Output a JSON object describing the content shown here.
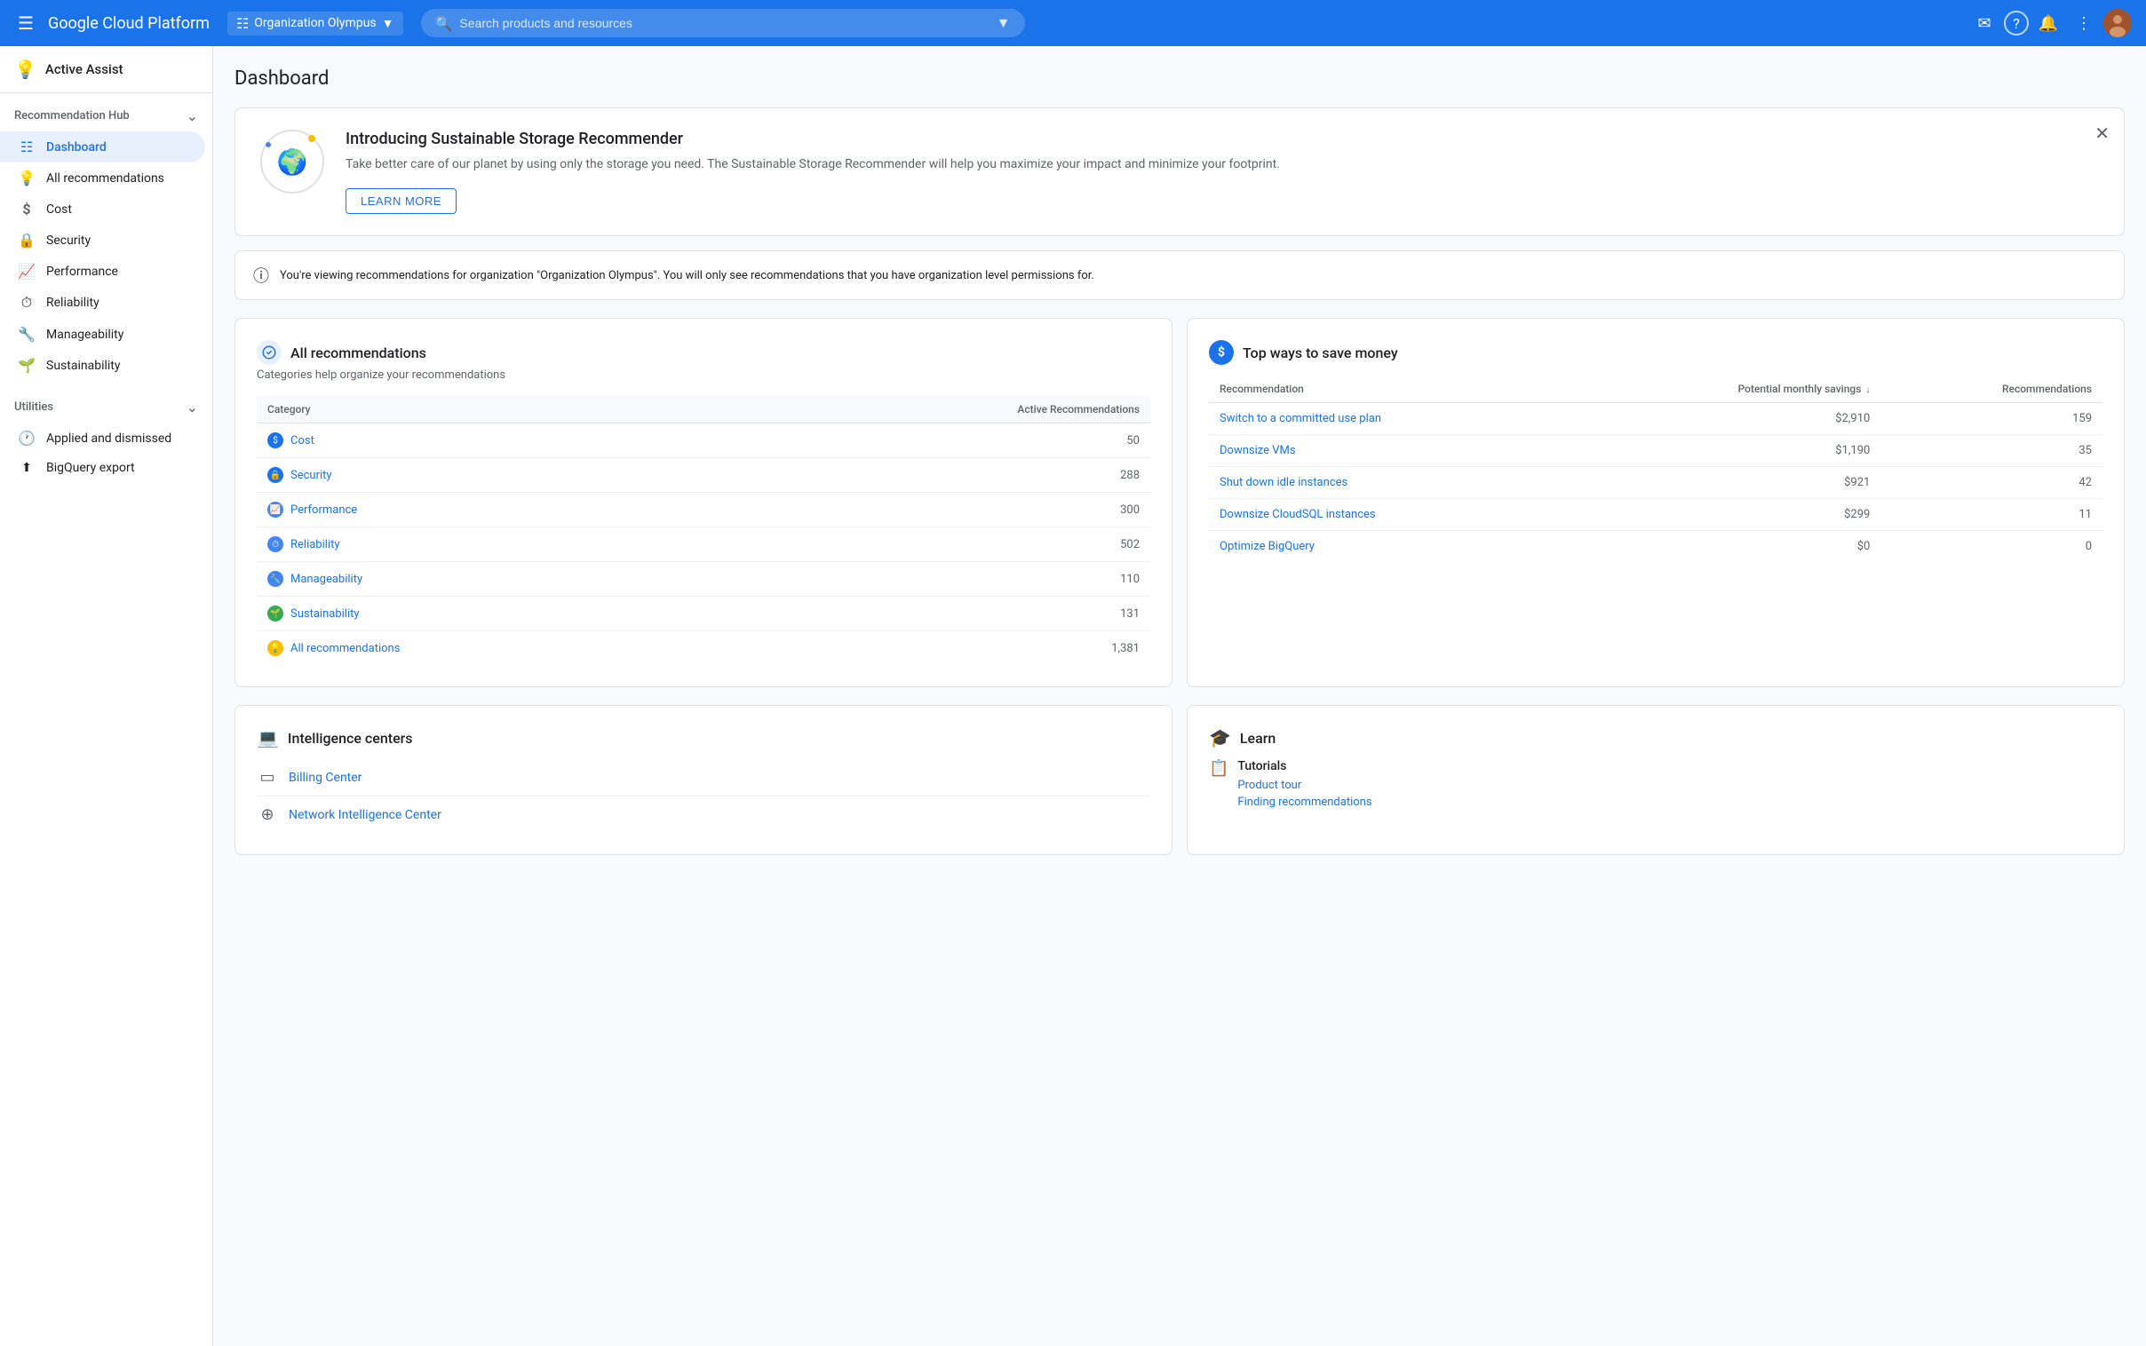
{
  "topNav": {
    "hamburger": "☰",
    "brand": "Google Cloud Platform",
    "org": {
      "icon": "⊞",
      "name": "Organization Olympus",
      "arrow": "▾"
    },
    "search": {
      "placeholder": "Search products and resources",
      "icon": "🔍",
      "dropdownArrow": "▾"
    },
    "actions": {
      "email": "✉",
      "help": "?",
      "bell": "🔔",
      "more": "⋮"
    }
  },
  "sidebar": {
    "activeAssist": {
      "icon": "💡",
      "label": "Active Assist"
    },
    "sections": [
      {
        "id": "recommendation-hub",
        "label": "Recommendation Hub",
        "hasChevron": true,
        "items": [
          {
            "id": "dashboard",
            "icon": "⊞",
            "label": "Dashboard",
            "active": true
          },
          {
            "id": "all-recommendations",
            "icon": "💡",
            "label": "All recommendations"
          }
        ]
      },
      {
        "id": "categories",
        "label": "",
        "items": [
          {
            "id": "cost",
            "icon": "$",
            "label": "Cost"
          },
          {
            "id": "security",
            "icon": "🔒",
            "label": "Security"
          },
          {
            "id": "performance",
            "icon": "📈",
            "label": "Performance"
          },
          {
            "id": "reliability",
            "icon": "⏱",
            "label": "Reliability"
          },
          {
            "id": "manageability",
            "icon": "🔧",
            "label": "Manageability"
          },
          {
            "id": "sustainability",
            "icon": "🌱",
            "label": "Sustainability"
          }
        ]
      },
      {
        "id": "utilities",
        "label": "Utilities",
        "hasChevron": true,
        "items": [
          {
            "id": "applied-dismissed",
            "icon": "🕐",
            "label": "Applied and dismissed"
          },
          {
            "id": "bigquery-export",
            "icon": "⬆",
            "label": "BigQuery export"
          }
        ]
      }
    ]
  },
  "main": {
    "title": "Dashboard",
    "banner": {
      "title": "Introducing Sustainable Storage Recommender",
      "description": "Take better care of our planet by using only the storage you need. The Sustainable Storage Recommender will help you maximize your impact and minimize your footprint.",
      "learnMoreLabel": "LEARN MORE"
    },
    "infoBar": {
      "icon": "ℹ",
      "text": "You're viewing recommendations for organization \"Organization Olympus\". You will only see recommendations that you have organization level permissions for."
    },
    "allRecommendations": {
      "title": "All recommendations",
      "subtitle": "Categories help organize your recommendations",
      "tableHeaders": {
        "category": "Category",
        "activeRecs": "Active Recommendations"
      },
      "rows": [
        {
          "id": "cost",
          "iconType": "cost",
          "iconSymbol": "$",
          "name": "Cost",
          "count": "50"
        },
        {
          "id": "security",
          "iconType": "security",
          "iconSymbol": "🔒",
          "name": "Security",
          "count": "288"
        },
        {
          "id": "performance",
          "iconType": "performance",
          "iconSymbol": "📈",
          "name": "Performance",
          "count": "300"
        },
        {
          "id": "reliability",
          "iconType": "reliability",
          "iconSymbol": "⏱",
          "name": "Reliability",
          "count": "502"
        },
        {
          "id": "manageability",
          "iconType": "manageability",
          "iconSymbol": "🔧",
          "name": "Manageability",
          "count": "110"
        },
        {
          "id": "sustainability",
          "iconType": "sustainability",
          "iconSymbol": "🌱",
          "name": "Sustainability",
          "count": "131"
        },
        {
          "id": "all",
          "iconType": "all",
          "iconSymbol": "💡",
          "name": "All recommendations",
          "count": "1,381"
        }
      ]
    },
    "topSavings": {
      "title": "Top ways to save money",
      "iconSymbol": "$",
      "tableHeaders": {
        "recommendation": "Recommendation",
        "monthlySavings": "Potential monthly savings",
        "count": "Recommendations"
      },
      "rows": [
        {
          "name": "Switch to a committed use plan",
          "savings": "$2,910",
          "count": "159"
        },
        {
          "name": "Downsize VMs",
          "savings": "$1,190",
          "count": "35"
        },
        {
          "name": "Shut down idle instances",
          "savings": "$921",
          "count": "42"
        },
        {
          "name": "Downsize CloudSQL instances",
          "savings": "$299",
          "count": "11"
        },
        {
          "name": "Optimize BigQuery",
          "savings": "$0",
          "count": "0"
        }
      ]
    },
    "intelligenceCenters": {
      "title": "Intelligence centers",
      "items": [
        {
          "id": "billing",
          "icon": "⬜",
          "label": "Billing Center"
        },
        {
          "id": "network",
          "icon": "⊕",
          "label": "Network Intelligence Center"
        }
      ]
    },
    "learn": {
      "title": "Learn",
      "tutorials": {
        "icon": "📋",
        "title": "Tutorials",
        "links": [
          {
            "id": "product-tour",
            "label": "Product tour"
          },
          {
            "id": "finding-recommendations",
            "label": "Finding recommendations"
          }
        ]
      }
    }
  }
}
